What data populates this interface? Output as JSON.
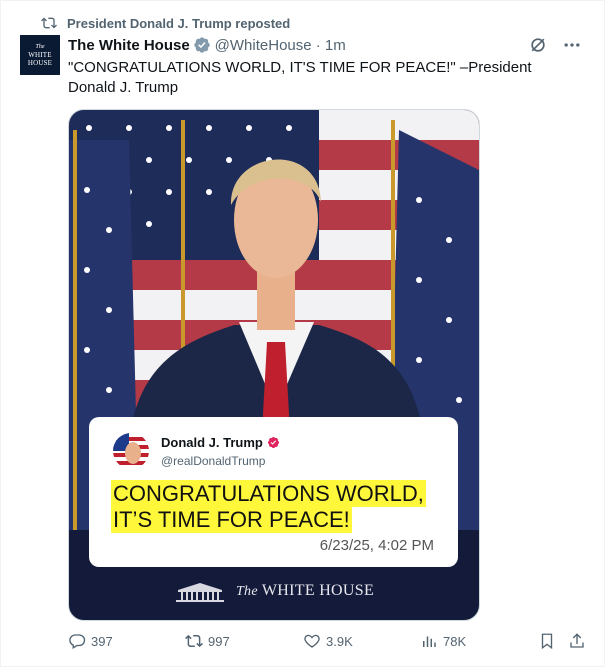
{
  "repost": {
    "text": "President Donald J. Trump reposted"
  },
  "author": {
    "avatar_line1": "The",
    "avatar_line2": "WHITE",
    "avatar_line3": "HOUSE",
    "name": "The White House",
    "handle_time": "@WhiteHouse · 1m"
  },
  "tweet": {
    "text": "\"CONGRATULATIONS WORLD, IT'S TIME FOR PEACE!\" –President Donald J. Trump"
  },
  "quote_card": {
    "name": "Donald J. Trump",
    "handle": "@realDonaldTrump",
    "message_line1": "CONGRATULATIONS WORLD,",
    "message_line2": "IT’S TIME FOR PEACE!",
    "timestamp": "6/23/25, 4:02 PM"
  },
  "brand": {
    "prefix": "The",
    "name": "WHITE HOUSE"
  },
  "actions": {
    "replies": "397",
    "reposts": "997",
    "likes": "3.9K",
    "views": "78K"
  },
  "colors": {
    "accent": "#1d9bf0",
    "verified_gold": "#829aab",
    "highlight": "#fff73a",
    "muted": "#536471"
  },
  "icons": [
    "repost-icon",
    "verified-icon",
    "grok-icon",
    "more-icon",
    "reply-icon",
    "like-icon",
    "views-icon",
    "bookmark-icon",
    "share-icon"
  ]
}
